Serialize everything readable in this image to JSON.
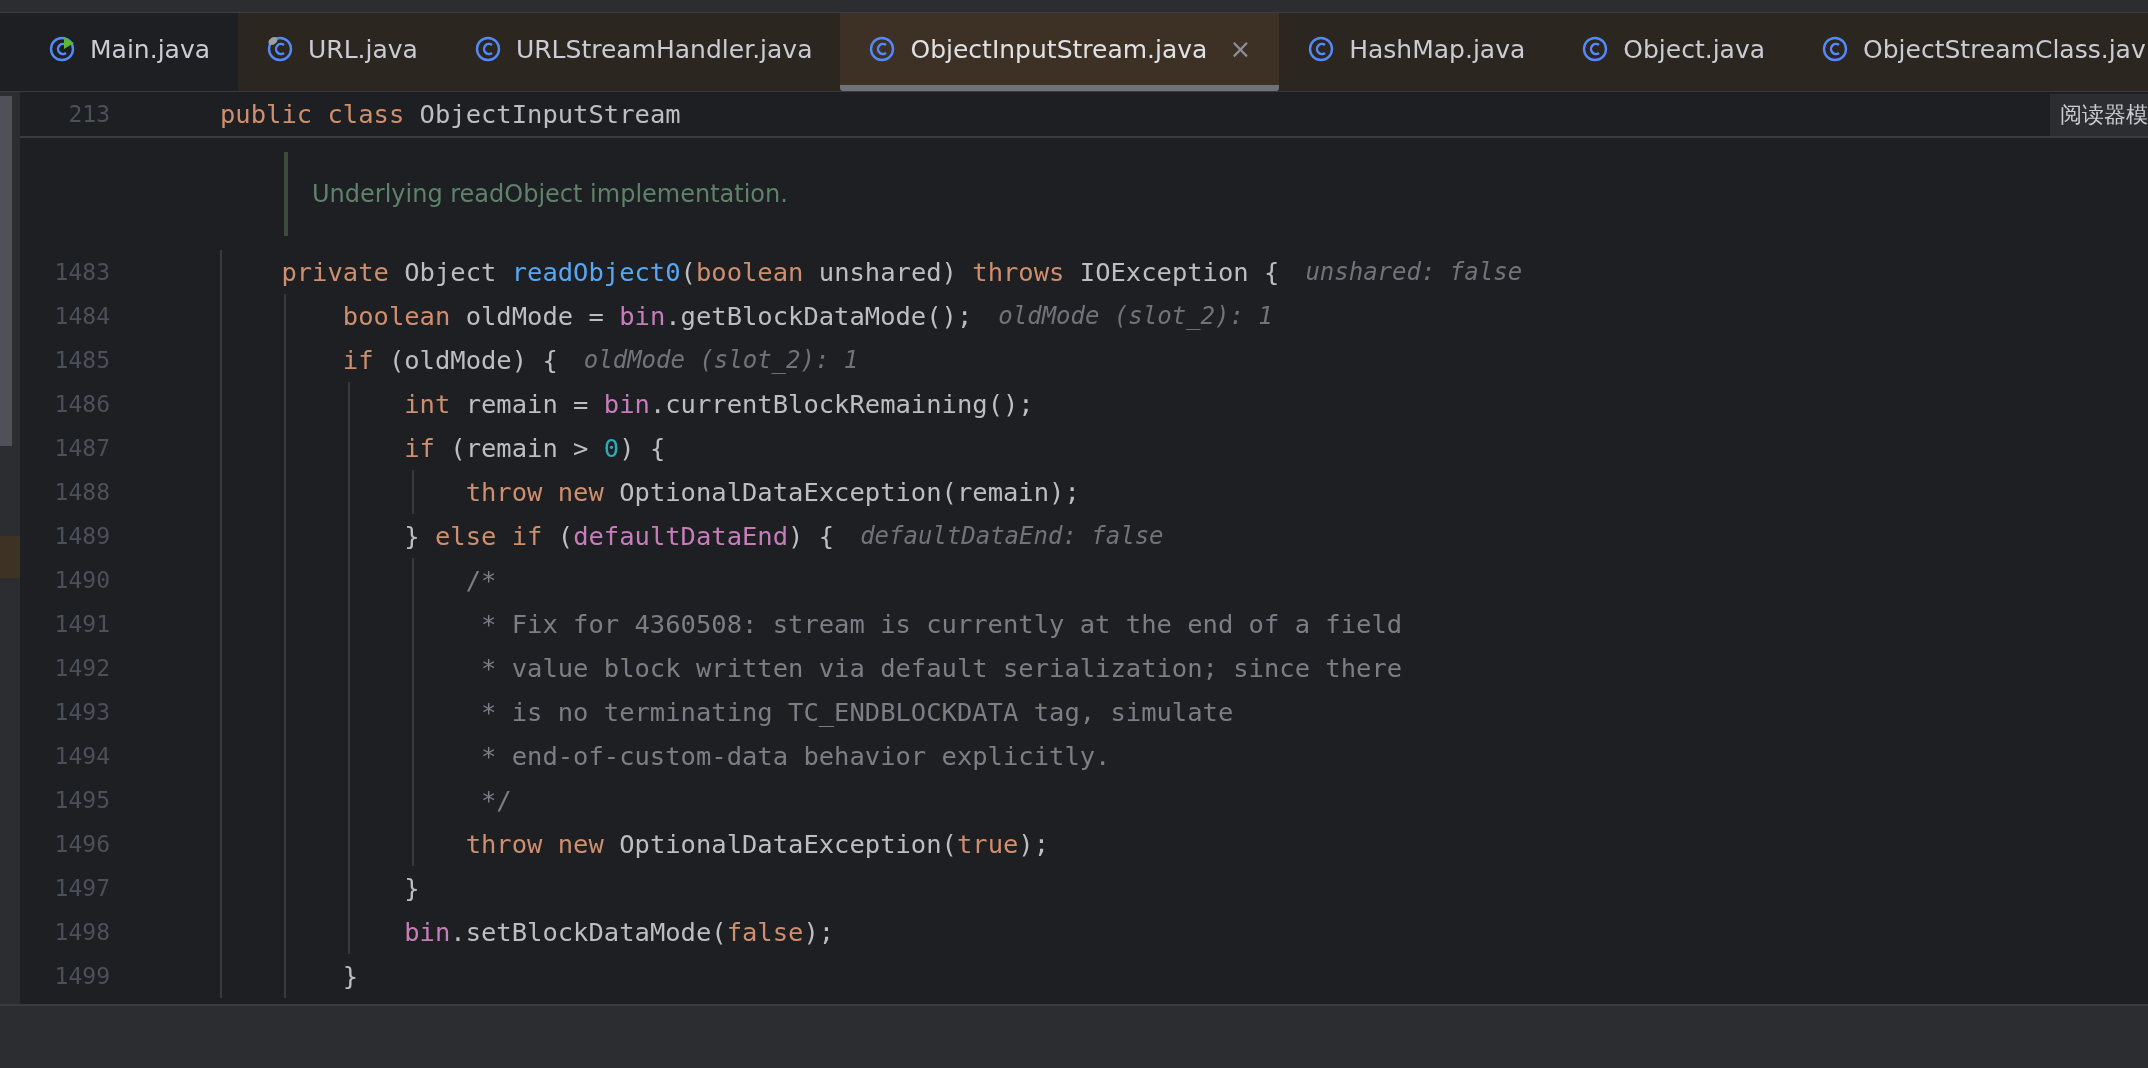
{
  "tabs": [
    {
      "label": "Main.java",
      "kind": "runnable",
      "selected": false
    },
    {
      "label": "URL.java",
      "kind": "linked",
      "selected": false
    },
    {
      "label": "URLStreamHandler.java",
      "kind": "class",
      "selected": false
    },
    {
      "label": "ObjectInputStream.java",
      "kind": "class",
      "selected": true,
      "close": "×"
    },
    {
      "label": "HashMap.java",
      "kind": "class",
      "selected": false
    },
    {
      "label": "Object.java",
      "kind": "class",
      "selected": false
    },
    {
      "label": "ObjectStreamClass.jav",
      "kind": "class",
      "selected": false
    }
  ],
  "sticky_header": {
    "number": "213",
    "tokens": [
      {
        "kind": "keyword",
        "text": "public class "
      },
      {
        "kind": "plain",
        "text": "ObjectInputStream"
      }
    ]
  },
  "popup_label": "阅读器模",
  "doc_comment": "Underlying readObject implementation.",
  "lines": [
    {
      "number": "1483",
      "tokens": [
        {
          "kind": "keyword",
          "text": "    private "
        },
        {
          "kind": "plain",
          "text": "Object "
        },
        {
          "kind": "method",
          "text": "readObject0"
        },
        {
          "kind": "plain",
          "text": "("
        },
        {
          "kind": "keyword",
          "text": "boolean "
        },
        {
          "kind": "plain",
          "text": "unshared) "
        },
        {
          "kind": "keyword",
          "text": "throws "
        },
        {
          "kind": "plain",
          "text": "IOException {"
        }
      ],
      "hint": "unshared: false"
    },
    {
      "number": "1484",
      "tokens": [
        {
          "kind": "keyword",
          "text": "        boolean "
        },
        {
          "kind": "plain",
          "text": "oldMode = "
        },
        {
          "kind": "field",
          "text": "bin"
        },
        {
          "kind": "plain",
          "text": ".getBlockDataMode();"
        }
      ],
      "hint": "oldMode (slot_2): 1"
    },
    {
      "number": "1485",
      "tokens": [
        {
          "kind": "keyword",
          "text": "        if "
        },
        {
          "kind": "plain",
          "text": "(oldMode) {"
        }
      ],
      "hint": "oldMode (slot_2): 1"
    },
    {
      "number": "1486",
      "tokens": [
        {
          "kind": "keyword",
          "text": "            int "
        },
        {
          "kind": "plain",
          "text": "remain = "
        },
        {
          "kind": "field",
          "text": "bin"
        },
        {
          "kind": "plain",
          "text": ".currentBlockRemaining();"
        }
      ]
    },
    {
      "number": "1487",
      "tokens": [
        {
          "kind": "keyword",
          "text": "            if "
        },
        {
          "kind": "plain",
          "text": "(remain > "
        },
        {
          "kind": "number",
          "text": "0"
        },
        {
          "kind": "plain",
          "text": ") {"
        }
      ]
    },
    {
      "number": "1488",
      "tokens": [
        {
          "kind": "keyword",
          "text": "                throw new "
        },
        {
          "kind": "plain",
          "text": "OptionalDataException(remain);"
        }
      ]
    },
    {
      "number": "1489",
      "tokens": [
        {
          "kind": "plain",
          "text": "            } "
        },
        {
          "kind": "keyword",
          "text": "else if "
        },
        {
          "kind": "plain",
          "text": "("
        },
        {
          "kind": "field",
          "text": "defaultDataEnd"
        },
        {
          "kind": "plain",
          "text": ") {"
        }
      ],
      "hint": "defaultDataEnd: false"
    },
    {
      "number": "1490",
      "tokens": [
        {
          "kind": "comment",
          "text": "                /*"
        }
      ]
    },
    {
      "number": "1491",
      "tokens": [
        {
          "kind": "comment",
          "text": "                 * Fix for 4360508: stream is currently at the end of a field"
        }
      ]
    },
    {
      "number": "1492",
      "tokens": [
        {
          "kind": "comment",
          "text": "                 * value block written via default serialization; since there"
        }
      ]
    },
    {
      "number": "1493",
      "tokens": [
        {
          "kind": "comment",
          "text": "                 * is no terminating TC_ENDBLOCKDATA tag, simulate"
        }
      ]
    },
    {
      "number": "1494",
      "tokens": [
        {
          "kind": "comment",
          "text": "                 * end-of-custom-data behavior explicitly."
        }
      ]
    },
    {
      "number": "1495",
      "tokens": [
        {
          "kind": "comment",
          "text": "                 */"
        }
      ]
    },
    {
      "number": "1496",
      "tokens": [
        {
          "kind": "keyword",
          "text": "                throw new "
        },
        {
          "kind": "plain",
          "text": "OptionalDataException("
        },
        {
          "kind": "keyword",
          "text": "true"
        },
        {
          "kind": "plain",
          "text": ");"
        }
      ]
    },
    {
      "number": "1497",
      "tokens": [
        {
          "kind": "plain",
          "text": "            }"
        }
      ]
    },
    {
      "number": "1498",
      "tokens": [
        {
          "kind": "field",
          "text": "            bin"
        },
        {
          "kind": "plain",
          "text": ".setBlockDataMode("
        },
        {
          "kind": "keyword",
          "text": "false"
        },
        {
          "kind": "plain",
          "text": ");"
        }
      ]
    },
    {
      "number": "1499",
      "tokens": [
        {
          "kind": "plain",
          "text": "        }"
        }
      ]
    }
  ]
}
